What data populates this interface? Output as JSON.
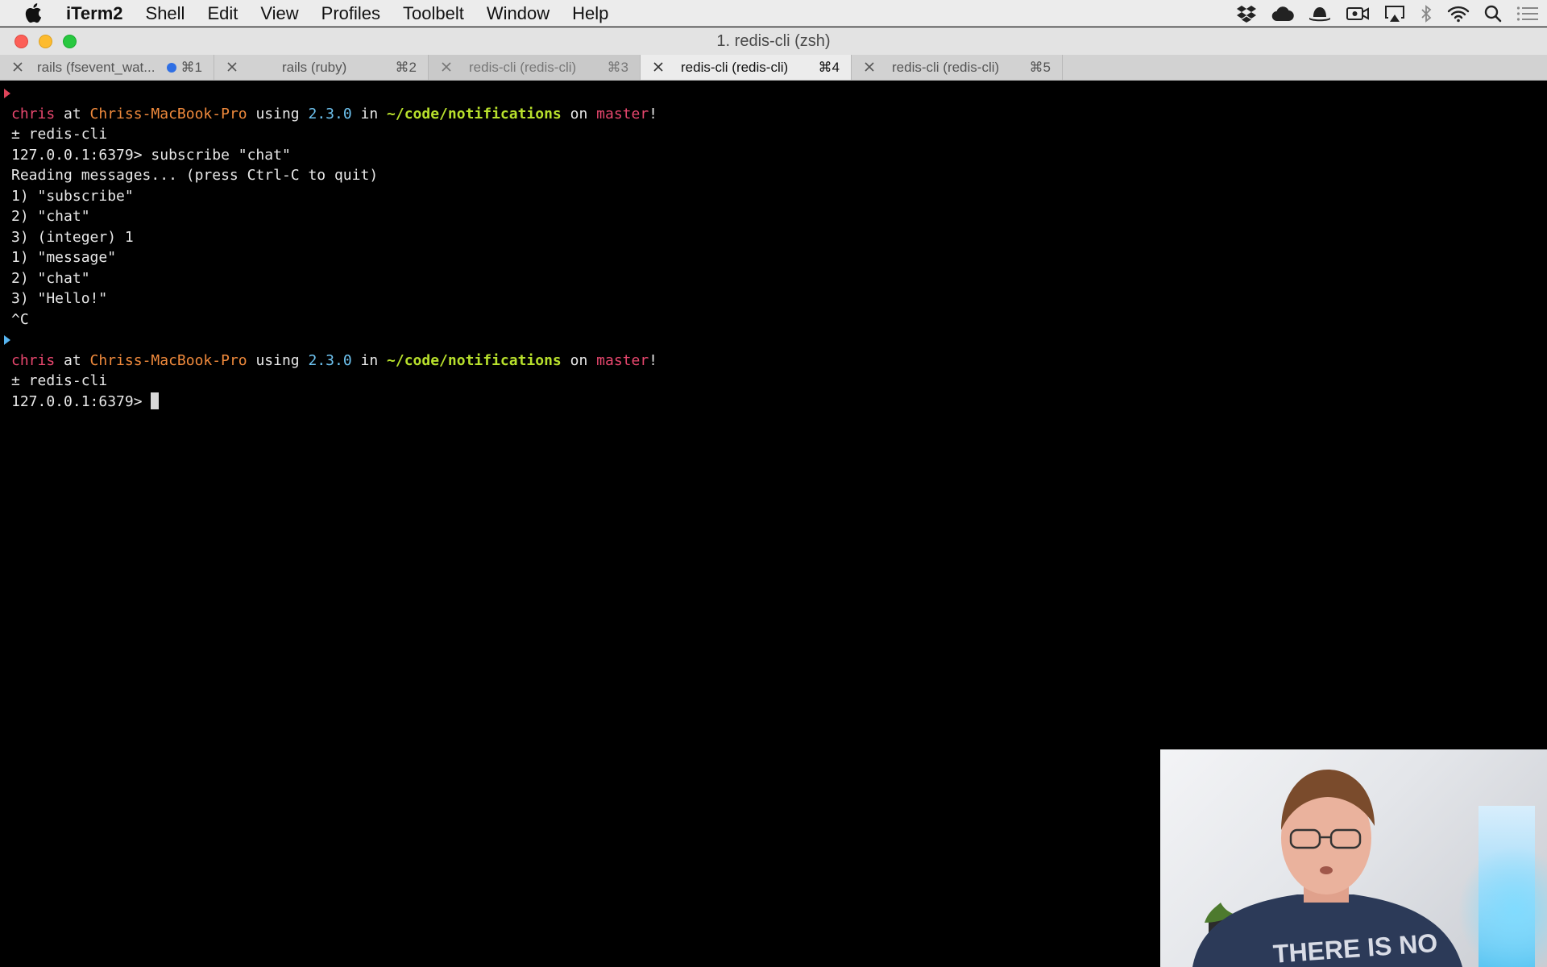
{
  "menubar": {
    "app_name": "iTerm2",
    "items": [
      "Shell",
      "Edit",
      "View",
      "Profiles",
      "Toolbelt",
      "Window",
      "Help"
    ]
  },
  "window": {
    "title": "1. redis-cli (zsh)"
  },
  "tabs": [
    {
      "label": "rails (fsevent_wat...",
      "shortcut": "⌘1",
      "state": "inactive",
      "has_activity": true
    },
    {
      "label": "rails (ruby)",
      "shortcut": "⌘2",
      "state": "inactive",
      "has_activity": false
    },
    {
      "label": "redis-cli (redis-cli)",
      "shortcut": "⌘3",
      "state": "dim",
      "has_activity": false
    },
    {
      "label": "redis-cli (redis-cli)",
      "shortcut": "⌘4",
      "state": "active",
      "has_activity": false
    },
    {
      "label": "redis-cli (redis-cli)",
      "shortcut": "⌘5",
      "state": "inactive",
      "has_activity": false
    }
  ],
  "terminal": {
    "prompt1": {
      "user": "chris",
      "at": " at ",
      "host": "Chriss-MacBook-Pro",
      "using": " using ",
      "version": "2.3.0",
      "in": " in ",
      "path": "~/code/notifications",
      "on": " on ",
      "branch": "master",
      "bang": "!"
    },
    "lines_block1": [
      "± redis-cli",
      "127.0.0.1:6379> subscribe \"chat\"",
      "Reading messages... (press Ctrl-C to quit)",
      "1) \"subscribe\"",
      "2) \"chat\"",
      "3) (integer) 1",
      "1) \"message\"",
      "2) \"chat\"",
      "3) \"Hello!\"",
      "^C"
    ],
    "prompt2": {
      "user": "chris",
      "at": " at ",
      "host": "Chriss-MacBook-Pro",
      "using": " using ",
      "version": "2.3.0",
      "in": " in ",
      "path": "~/code/notifications",
      "on": " on ",
      "branch": "master",
      "bang": "!"
    },
    "lines_block2": [
      "± redis-cli",
      "127.0.0.1:6379> "
    ]
  },
  "webcam": {
    "shirt_text": "THERE IS NO"
  },
  "colors": {
    "prompt_user": "#e8476e",
    "prompt_host": "#f08a3c",
    "prompt_version": "#6ec3f0",
    "prompt_path": "#b8e02c",
    "activity_dot": "#2f6fe4"
  },
  "icons": [
    "apple-icon",
    "dropbox-icon",
    "cloud-icon",
    "bowler-hat-icon",
    "camera-icon",
    "airplay-icon",
    "bluetooth-icon",
    "wifi-icon",
    "search-icon",
    "notification-list-icon"
  ]
}
